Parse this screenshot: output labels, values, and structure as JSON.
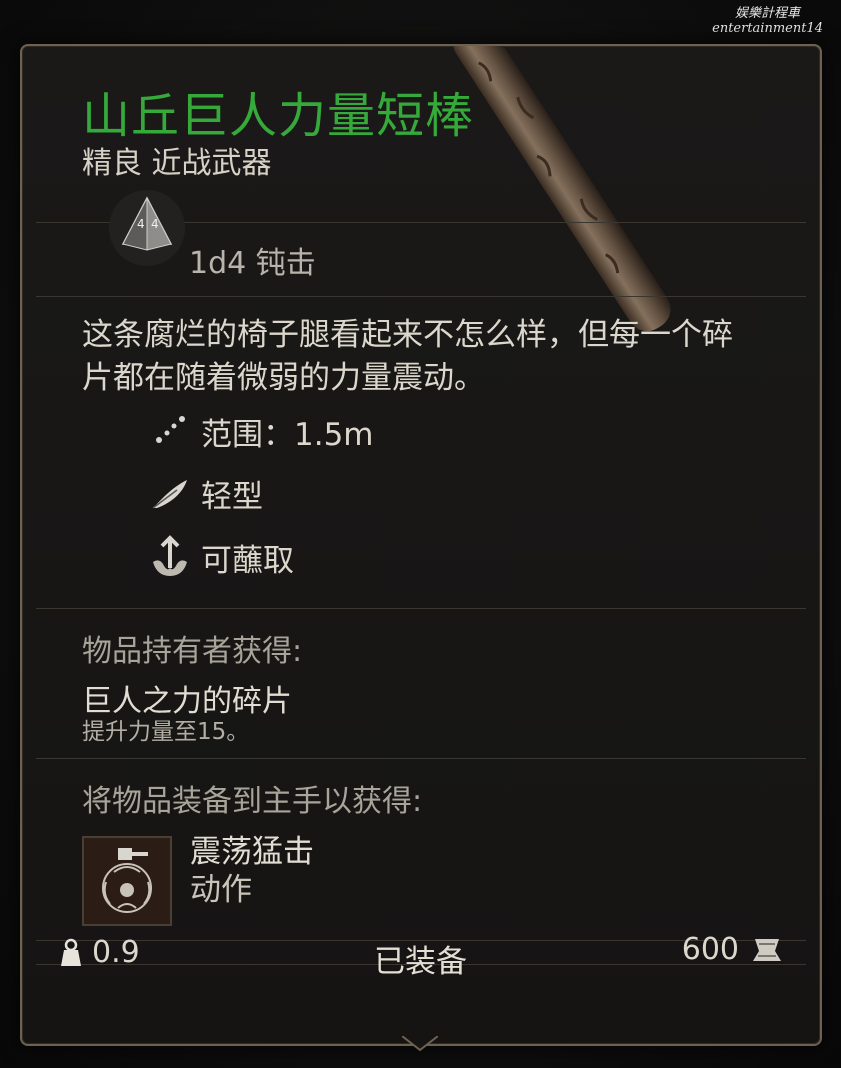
{
  "watermark": {
    "line1": "娱樂計程車",
    "line2": "entertainment14"
  },
  "item": {
    "name": "山丘巨人力量短棒",
    "rarity_type": "精良 近战武器",
    "damage": "1d4 钝击",
    "dice_face": "4",
    "description": "这条腐烂的椅子腿看起来不怎么样，但每一个碎片都在随着微弱的力量震动。",
    "properties": [
      {
        "icon": "range-icon",
        "label": "范围：1.5m"
      },
      {
        "icon": "feather-icon",
        "label": "轻型"
      },
      {
        "icon": "dip-icon",
        "label": "可蘸取"
      }
    ]
  },
  "holder_section": {
    "heading": "物品持有者获得:",
    "name": "巨人之力的碎片",
    "desc": "提升力量至15。"
  },
  "equip_section": {
    "heading": "将物品装备到主手以获得:",
    "action_name": "震荡猛击",
    "action_type": "动作"
  },
  "footer": {
    "weight": "0.9",
    "status": "已装备",
    "price": "600"
  },
  "colors": {
    "title": "#35a93a",
    "border": "#6d6150",
    "panel_bg": "#171615"
  }
}
